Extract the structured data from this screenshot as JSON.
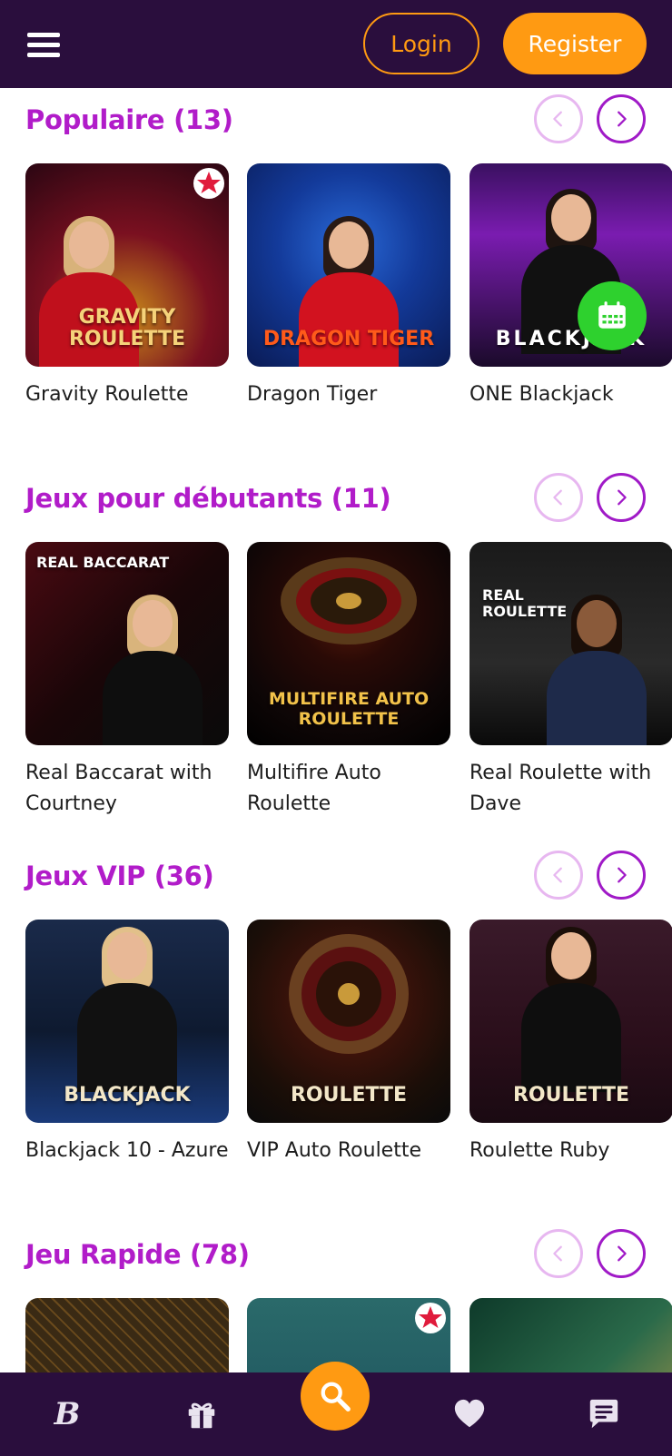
{
  "header": {
    "login_label": "Login",
    "register_label": "Register",
    "accent_color": "#ff9a12",
    "bg_color": "#2a0e3d"
  },
  "sections": [
    {
      "title": "Populaire (13)",
      "cards": [
        {
          "label": "Gravity Roulette",
          "thumb_text": "GRAVITY ROULETTE"
        },
        {
          "label": "Dragon Tiger",
          "thumb_text": "DRAGON TIGER"
        },
        {
          "label": "ONE Blackjack",
          "thumb_text": "BLACKJACK"
        }
      ]
    },
    {
      "title": "Jeux pour débutants (11)",
      "cards": [
        {
          "label": "Real Baccarat with Courtney",
          "thumb_text": "REAL BACCARAT"
        },
        {
          "label": "Multifire Auto Roulette",
          "thumb_text": "MULTIFIRE AUTO ROULETTE"
        },
        {
          "label": "Real Roulette with Dave",
          "thumb_text": "REAL ROULETTE"
        }
      ]
    },
    {
      "title": "Jeux VIP (36)",
      "cards": [
        {
          "label": "Blackjack 10 - Azure",
          "thumb_text": "BLACKJACK"
        },
        {
          "label": "VIP Auto Roulette",
          "thumb_text": "ROULETTE"
        },
        {
          "label": "Roulette Ruby",
          "thumb_text": "ROULETTE"
        }
      ]
    },
    {
      "title": "Jeu Rapide (78)",
      "cards": [
        {
          "label": "",
          "thumb_text": ""
        },
        {
          "label": "",
          "thumb_text": ""
        },
        {
          "label": "",
          "thumb_text": ""
        }
      ]
    }
  ],
  "icons": {
    "menu": "hamburger-menu-icon",
    "prev": "chevron-left-icon",
    "next": "chevron-right-icon",
    "calendar": "calendar-icon",
    "star": "star-badge-icon",
    "brand": "brand-logo-icon",
    "gift": "gift-icon",
    "search": "search-icon",
    "heart": "heart-icon",
    "chat": "chat-icon"
  },
  "colors": {
    "section_title": "#b11cc9",
    "arrow_active": "#a01ac7",
    "arrow_inactive": "#e7b7f0",
    "nav_bg": "#2a0e3d",
    "calendar_fab": "#2ed12e"
  }
}
